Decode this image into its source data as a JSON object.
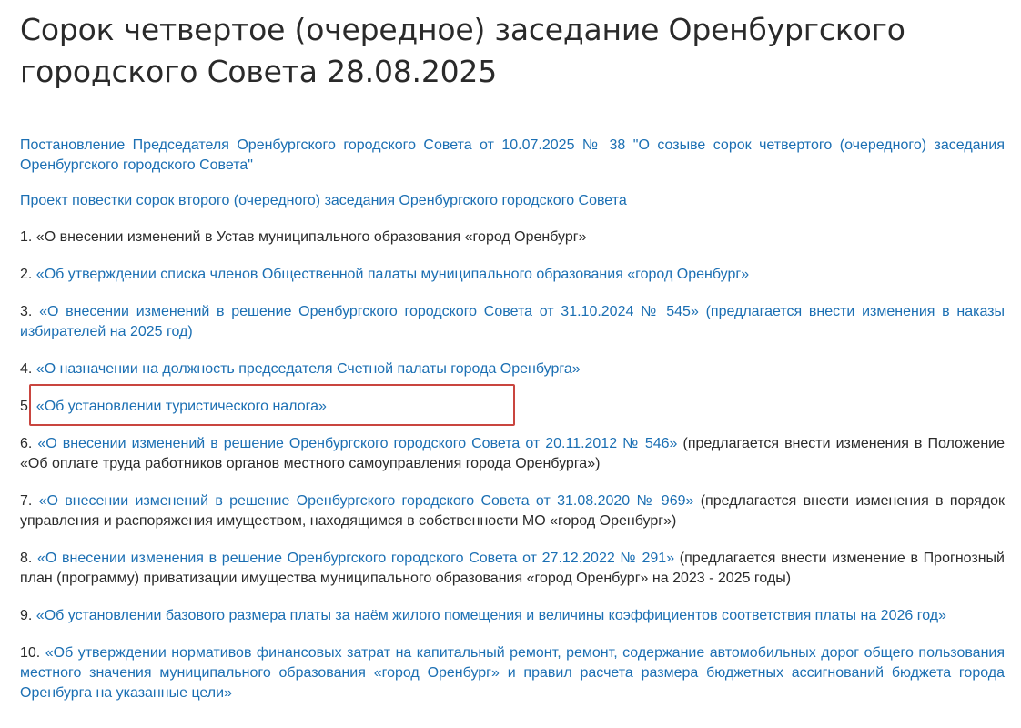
{
  "document": {
    "title_line1": "Сорок четвертое (очередное) заседание Оренбургского",
    "title_line2": "городского Совета 28.08.2025"
  },
  "links": {
    "resolution": "Постановление Председателя Оренбургского городского Совета от 10.07.2025 № 38 \"О созыве сорок четвертого (очередного) заседания Оренбургского городского Совета\"",
    "agenda": "Проект повестки сорок второго (очередного) заседания Оренбургского городского Совета"
  },
  "items": [
    {
      "num": "1.",
      "link": "«О внесении изменений в Устав муниципального образования «город Оренбург»",
      "note": ""
    },
    {
      "num": "2.",
      "link": "«Об утверждении списка членов Общественной палаты муниципального образования «город Оренбург»",
      "note": ""
    },
    {
      "num": "3.",
      "link": "«О внесении изменений в решение Оренбургского городского Совета от 31.10.2024 № 545» (предлагается внести изменения в наказы избирателей на 2025 год)",
      "note": ""
    },
    {
      "num": "4.",
      "link": "«О назначении на должность председателя Счетной палаты города Оренбурга»",
      "note": ""
    },
    {
      "num": "5.",
      "link": "«Об установлении туристического налога»",
      "note": ""
    },
    {
      "num": "6.",
      "link": "«О внесении изменений в решение Оренбургского городского Совета от 20.11.2012 № 546»",
      "note": "(предлагается внести изменения в Положение «Об оплате труда работников органов местного самоуправления города Оренбурга»)"
    },
    {
      "num": "7.",
      "link": "«О внесении изменений в решение Оренбургского городского Совета от 31.08.2020 № 969»",
      "note": "(предлагается внести изменения в порядок управления и распоряжения имуществом, находящимся в собственности МО «город Оренбург»)"
    },
    {
      "num": "8.",
      "link": "«О внесении изменения в решение Оренбургского городского Совета от 27.12.2022 № 291»",
      "note": "(предлагается внести изменение в Прогнозный план (программу) приватизации имущества муниципального образования «город Оренбург» на 2023 - 2025 годы)"
    },
    {
      "num": "9.",
      "link": "«Об установлении базового размера платы за наём жилого помещения и величины коэффициентов соответствия платы на 2026 год»",
      "note": ""
    },
    {
      "num": "10.",
      "link": "«Об утверждении нормативов финансовых затрат на капитальный ремонт, ремонт, содержание автомобильных дорог общего пользования местного значения муниципального образования «город Оренбург» и правил расчета размера бюджетных ассигнований бюджета города Оренбурга на указанные цели»",
      "note": ""
    }
  ],
  "colors": {
    "link": "#1b6fb3",
    "text": "#2b2b2b",
    "highlight_border": "#c9453f"
  }
}
